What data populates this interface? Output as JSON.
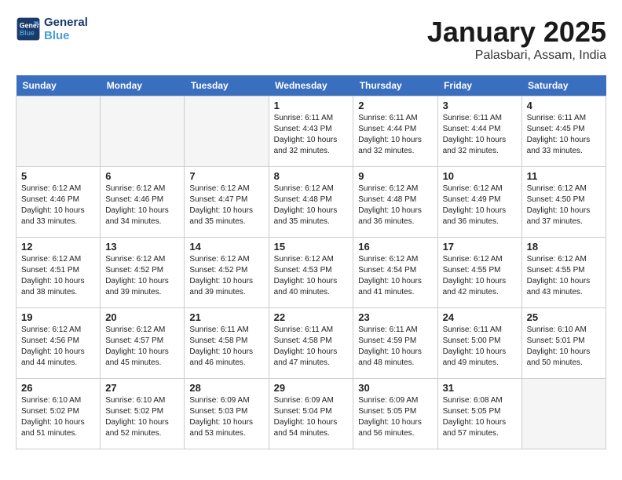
{
  "header": {
    "logo_line1": "General",
    "logo_line2": "Blue",
    "month_title": "January 2025",
    "location": "Palasbari, Assam, India"
  },
  "weekdays": [
    "Sunday",
    "Monday",
    "Tuesday",
    "Wednesday",
    "Thursday",
    "Friday",
    "Saturday"
  ],
  "weeks": [
    [
      {
        "num": "",
        "info": ""
      },
      {
        "num": "",
        "info": ""
      },
      {
        "num": "",
        "info": ""
      },
      {
        "num": "1",
        "info": "Sunrise: 6:11 AM\nSunset: 4:43 PM\nDaylight: 10 hours\nand 32 minutes."
      },
      {
        "num": "2",
        "info": "Sunrise: 6:11 AM\nSunset: 4:44 PM\nDaylight: 10 hours\nand 32 minutes."
      },
      {
        "num": "3",
        "info": "Sunrise: 6:11 AM\nSunset: 4:44 PM\nDaylight: 10 hours\nand 32 minutes."
      },
      {
        "num": "4",
        "info": "Sunrise: 6:11 AM\nSunset: 4:45 PM\nDaylight: 10 hours\nand 33 minutes."
      }
    ],
    [
      {
        "num": "5",
        "info": "Sunrise: 6:12 AM\nSunset: 4:46 PM\nDaylight: 10 hours\nand 33 minutes."
      },
      {
        "num": "6",
        "info": "Sunrise: 6:12 AM\nSunset: 4:46 PM\nDaylight: 10 hours\nand 34 minutes."
      },
      {
        "num": "7",
        "info": "Sunrise: 6:12 AM\nSunset: 4:47 PM\nDaylight: 10 hours\nand 35 minutes."
      },
      {
        "num": "8",
        "info": "Sunrise: 6:12 AM\nSunset: 4:48 PM\nDaylight: 10 hours\nand 35 minutes."
      },
      {
        "num": "9",
        "info": "Sunrise: 6:12 AM\nSunset: 4:48 PM\nDaylight: 10 hours\nand 36 minutes."
      },
      {
        "num": "10",
        "info": "Sunrise: 6:12 AM\nSunset: 4:49 PM\nDaylight: 10 hours\nand 36 minutes."
      },
      {
        "num": "11",
        "info": "Sunrise: 6:12 AM\nSunset: 4:50 PM\nDaylight: 10 hours\nand 37 minutes."
      }
    ],
    [
      {
        "num": "12",
        "info": "Sunrise: 6:12 AM\nSunset: 4:51 PM\nDaylight: 10 hours\nand 38 minutes."
      },
      {
        "num": "13",
        "info": "Sunrise: 6:12 AM\nSunset: 4:52 PM\nDaylight: 10 hours\nand 39 minutes."
      },
      {
        "num": "14",
        "info": "Sunrise: 6:12 AM\nSunset: 4:52 PM\nDaylight: 10 hours\nand 39 minutes."
      },
      {
        "num": "15",
        "info": "Sunrise: 6:12 AM\nSunset: 4:53 PM\nDaylight: 10 hours\nand 40 minutes."
      },
      {
        "num": "16",
        "info": "Sunrise: 6:12 AM\nSunset: 4:54 PM\nDaylight: 10 hours\nand 41 minutes."
      },
      {
        "num": "17",
        "info": "Sunrise: 6:12 AM\nSunset: 4:55 PM\nDaylight: 10 hours\nand 42 minutes."
      },
      {
        "num": "18",
        "info": "Sunrise: 6:12 AM\nSunset: 4:55 PM\nDaylight: 10 hours\nand 43 minutes."
      }
    ],
    [
      {
        "num": "19",
        "info": "Sunrise: 6:12 AM\nSunset: 4:56 PM\nDaylight: 10 hours\nand 44 minutes."
      },
      {
        "num": "20",
        "info": "Sunrise: 6:12 AM\nSunset: 4:57 PM\nDaylight: 10 hours\nand 45 minutes."
      },
      {
        "num": "21",
        "info": "Sunrise: 6:11 AM\nSunset: 4:58 PM\nDaylight: 10 hours\nand 46 minutes."
      },
      {
        "num": "22",
        "info": "Sunrise: 6:11 AM\nSunset: 4:58 PM\nDaylight: 10 hours\nand 47 minutes."
      },
      {
        "num": "23",
        "info": "Sunrise: 6:11 AM\nSunset: 4:59 PM\nDaylight: 10 hours\nand 48 minutes."
      },
      {
        "num": "24",
        "info": "Sunrise: 6:11 AM\nSunset: 5:00 PM\nDaylight: 10 hours\nand 49 minutes."
      },
      {
        "num": "25",
        "info": "Sunrise: 6:10 AM\nSunset: 5:01 PM\nDaylight: 10 hours\nand 50 minutes."
      }
    ],
    [
      {
        "num": "26",
        "info": "Sunrise: 6:10 AM\nSunset: 5:02 PM\nDaylight: 10 hours\nand 51 minutes."
      },
      {
        "num": "27",
        "info": "Sunrise: 6:10 AM\nSunset: 5:02 PM\nDaylight: 10 hours\nand 52 minutes."
      },
      {
        "num": "28",
        "info": "Sunrise: 6:09 AM\nSunset: 5:03 PM\nDaylight: 10 hours\nand 53 minutes."
      },
      {
        "num": "29",
        "info": "Sunrise: 6:09 AM\nSunset: 5:04 PM\nDaylight: 10 hours\nand 54 minutes."
      },
      {
        "num": "30",
        "info": "Sunrise: 6:09 AM\nSunset: 5:05 PM\nDaylight: 10 hours\nand 56 minutes."
      },
      {
        "num": "31",
        "info": "Sunrise: 6:08 AM\nSunset: 5:05 PM\nDaylight: 10 hours\nand 57 minutes."
      },
      {
        "num": "",
        "info": ""
      }
    ]
  ]
}
